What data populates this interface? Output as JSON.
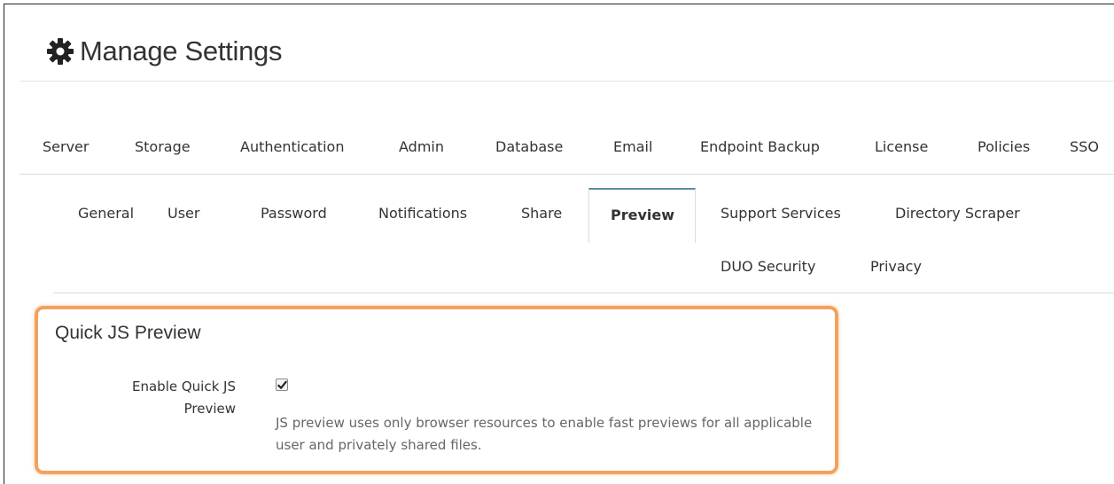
{
  "header": {
    "title": "Manage Settings",
    "icon": "gear-icon"
  },
  "main_tabs": [
    "Server",
    "Storage",
    "Authentication",
    "Admin",
    "Database",
    "Email",
    "Endpoint Backup",
    "License",
    "Policies",
    "SSO"
  ],
  "sub_tabs": {
    "row1": [
      "General",
      "User",
      "Password",
      "Notifications",
      "Share",
      "Preview",
      "Support Services",
      "Directory Scraper"
    ],
    "row2": [
      "DUO Security",
      "Privacy"
    ],
    "active": "Preview"
  },
  "section": {
    "title": "Quick JS Preview",
    "field_label": "Enable Quick JS Preview",
    "checkbox_checked": true,
    "help_text": "JS preview uses only browser resources to enable fast previews for all applicable user and privately shared files."
  },
  "colors": {
    "highlight_border": "#f0a35e",
    "active_tab_accent": "#5a8ca5"
  }
}
